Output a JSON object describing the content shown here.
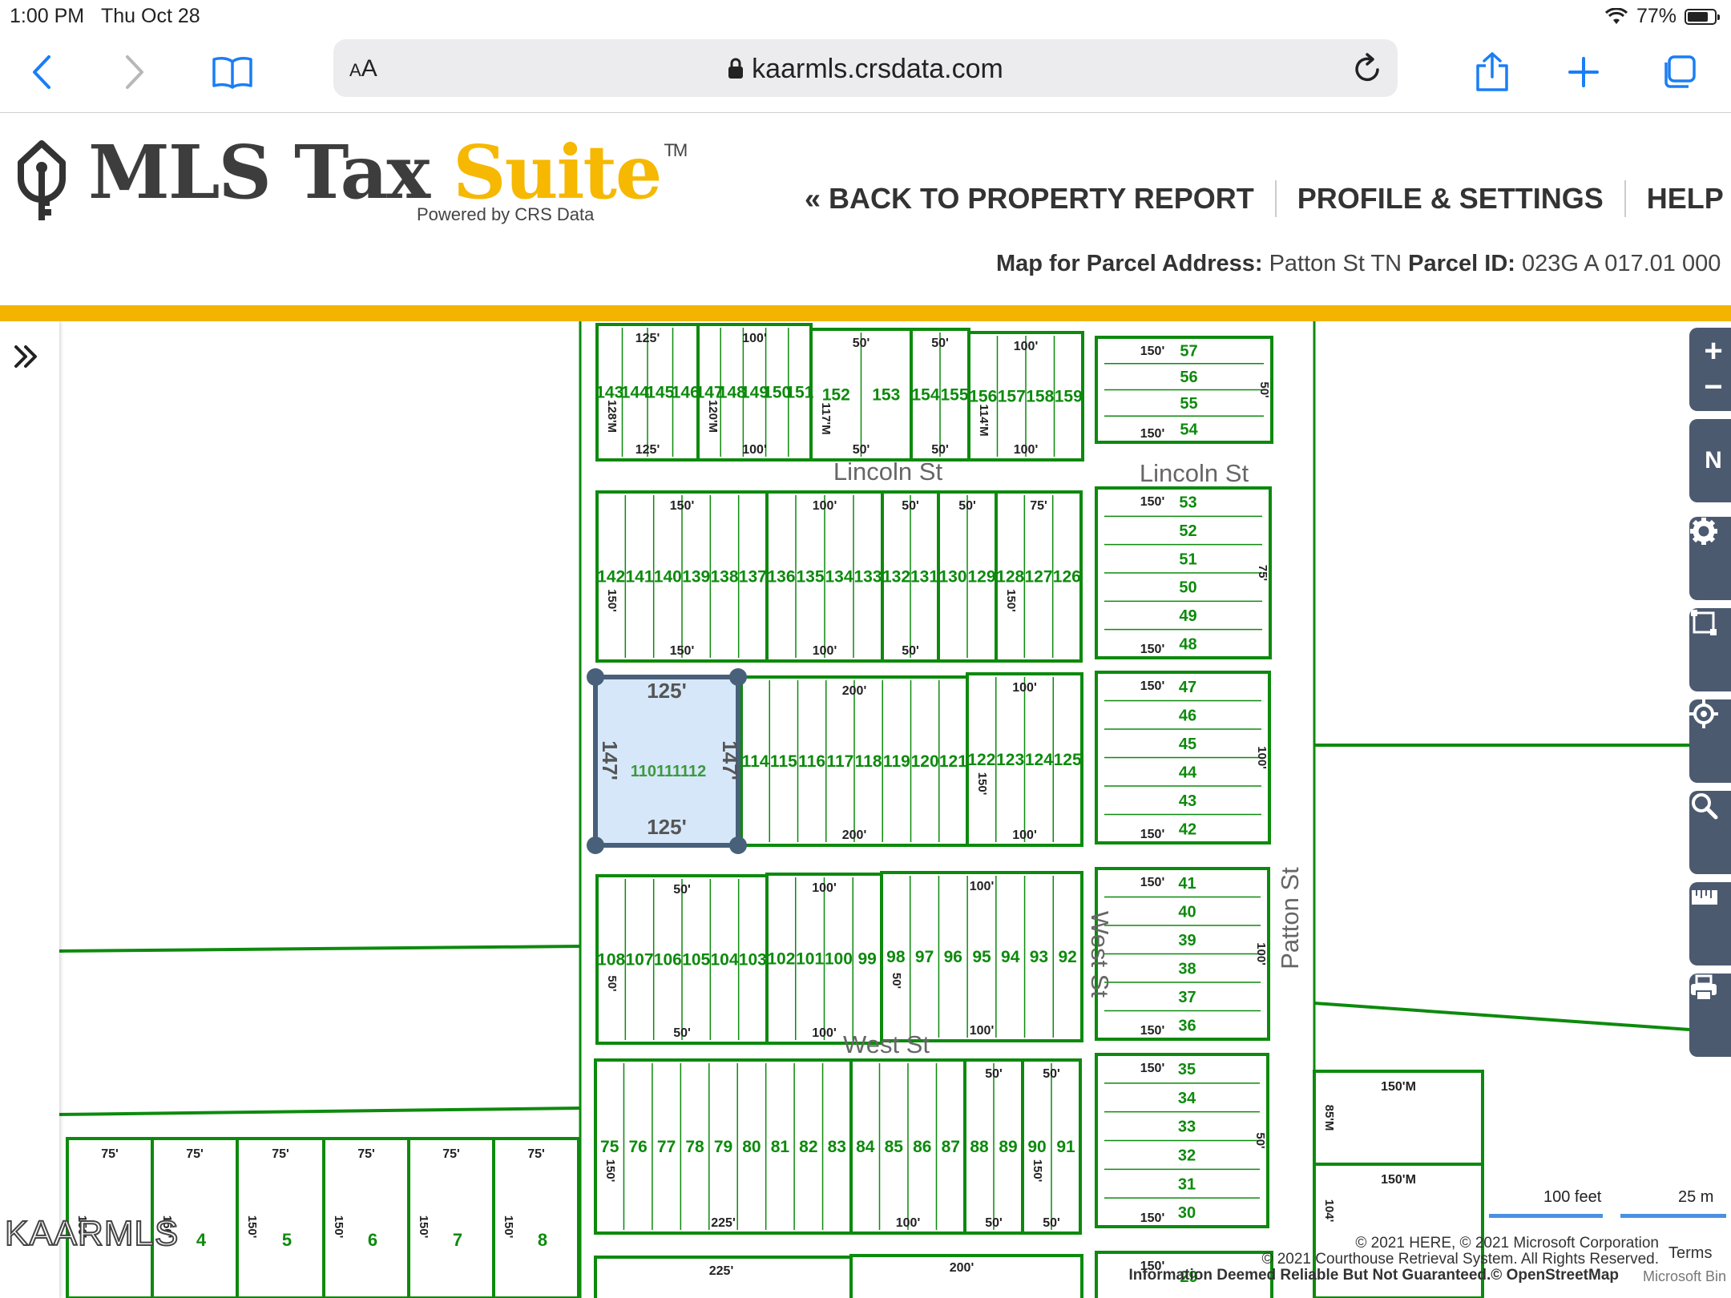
{
  "status": {
    "time": "1:00 PM",
    "date": "Thu Oct 28",
    "battery": "77%",
    "battery_level": 0.77
  },
  "browser": {
    "aa": "A",
    "url": "kaarmls.crsdata.com"
  },
  "header": {
    "brand_main": "MLS Tax ",
    "brand_accent": "Suite",
    "brand_tm": "TM",
    "powered": "Powered by CRS Data",
    "nav": [
      "« BACK TO PROPERTY REPORT",
      "PROFILE & SETTINGS",
      "HELP"
    ],
    "parcel_label_1": "Map for Parcel Address:",
    "parcel_address": " Patton St TN ",
    "parcel_label_2": "Parcel ID:",
    "parcel_id": " 023G A 017.01 000"
  },
  "map": {
    "colors": {
      "lot": "#0d8a0d",
      "selected_fill": "#cfe3f8",
      "selected_stroke": "#48607a",
      "road_label": "#666666"
    },
    "streets": [
      {
        "name": "Lincoln St"
      },
      {
        "name": "Lincoln St"
      },
      {
        "name": "West St"
      },
      {
        "name": "West St"
      },
      {
        "name": "Patton St"
      }
    ],
    "selected_parcel": {
      "top": "125'",
      "bottom": "125'",
      "left": "147'",
      "right": "147'",
      "lots": "110111112"
    },
    "blocks": [
      {
        "top": "125'",
        "bottom": "125'",
        "lots": [
          "143",
          "144",
          "145",
          "146"
        ],
        "side": "128'M"
      },
      {
        "top": "100'",
        "bottom": "100'",
        "lots": [
          "147",
          "148",
          "149",
          "150",
          "151"
        ],
        "side": "120'M"
      },
      {
        "top": "50'",
        "bottom": "50'",
        "lots": [
          "152",
          "153"
        ],
        "side": "117'M"
      },
      {
        "top": "50'",
        "bottom": "50'",
        "lots": [
          "154",
          "155"
        ]
      },
      {
        "top": "100'",
        "bottom": "100'",
        "lots": [
          "156",
          "157",
          "158",
          "159"
        ],
        "side": "114'M"
      },
      {
        "top": "150'",
        "bottom": "150'",
        "lots": [
          "142",
          "141",
          "140",
          "139",
          "138",
          "137"
        ],
        "side": "150'"
      },
      {
        "top": "100'",
        "bottom": "100'",
        "lots": [
          "136",
          "135",
          "134",
          "133"
        ]
      },
      {
        "top": "50'",
        "bottom": "50'",
        "lots": [
          "132",
          "131"
        ]
      },
      {
        "top": "50'",
        "bottom": "",
        "lots": [
          "130",
          "129"
        ]
      },
      {
        "top": "75'",
        "bottom": "",
        "lots": [
          "128",
          "127",
          "126"
        ],
        "side": "150'"
      },
      {
        "top": "200'",
        "bottom": "200'",
        "lots": [
          "114",
          "115",
          "116",
          "117",
          "118",
          "119",
          "120",
          "121"
        ]
      },
      {
        "top": "100'",
        "bottom": "100'",
        "lots": [
          "122",
          "123",
          "124",
          "125"
        ],
        "side": "150'"
      },
      {
        "top": "50'",
        "bottom": "50'",
        "lots": [
          "108",
          "107",
          "106",
          "105",
          "104",
          "103"
        ],
        "side": "50'"
      },
      {
        "top": "100'",
        "bottom": "100'",
        "lots": [
          "102",
          "101",
          "100",
          "99"
        ]
      },
      {
        "top": "100'",
        "bottom": "100'",
        "lots": [
          "98",
          "97",
          "96",
          "95",
          "94",
          "93",
          "92"
        ],
        "side": "50'"
      },
      {
        "top": "",
        "bottom": "225'",
        "lots": [
          "75",
          "76",
          "77",
          "78",
          "79",
          "80",
          "81",
          "82",
          "83"
        ],
        "side": "150'"
      },
      {
        "top": "",
        "bottom": "100'",
        "lots": [
          "84",
          "85",
          "86",
          "87"
        ]
      },
      {
        "top": "50'",
        "bottom": "50'",
        "lots": [
          "88",
          "89"
        ]
      },
      {
        "top": "50'",
        "bottom": "50'",
        "lots": [
          "90",
          "91"
        ],
        "side": "150'"
      }
    ],
    "east_column": [
      {
        "top": "150'",
        "bottom": "150'",
        "lots": [
          "57",
          "56",
          "55",
          "54"
        ],
        "side": "50'"
      },
      {
        "top": "150'",
        "bottom": "150'",
        "lots": [
          "53",
          "52",
          "51",
          "50",
          "49",
          "48"
        ],
        "side": "75'"
      },
      {
        "top": "150'",
        "bottom": "150'",
        "lots": [
          "47",
          "46",
          "45",
          "44",
          "43",
          "42"
        ],
        "side": "100'"
      },
      {
        "top": "150'",
        "bottom": "150'",
        "lots": [
          "41",
          "40",
          "39",
          "38",
          "37",
          "36"
        ],
        "side": "100'"
      },
      {
        "top": "150'",
        "bottom": "150'",
        "lots": [
          "35",
          "34",
          "33",
          "32",
          "31",
          "30"
        ],
        "side": "50'"
      },
      {
        "top": "150'",
        "bottom": "",
        "lots": [
          "29"
        ]
      }
    ],
    "south_row": [
      {
        "top": "75'",
        "lot": "",
        "side": "150'"
      },
      {
        "top": "75'",
        "lot": "4",
        "side": "150'"
      },
      {
        "top": "75'",
        "lot": "5",
        "side": "150'"
      },
      {
        "top": "75'",
        "lot": "6",
        "side": "150'"
      },
      {
        "top": "75'",
        "lot": "7",
        "side": "150'"
      },
      {
        "top": "75'",
        "lot": "8",
        "side": "150'"
      }
    ],
    "patton_east": [
      {
        "top": "150'M",
        "side": "85'M"
      },
      {
        "top": "150'M",
        "side": "104'"
      }
    ],
    "bottom_extra": [
      "225'",
      "200'"
    ],
    "scale": {
      "feet": "100 feet",
      "meters": "25 m"
    },
    "copyright": [
      "© 2021 HERE, © 2021 Microsoft Corporation",
      "© 2021 Courthouse Retrieval System. All Rights Reserved.",
      "Information Deemed Reliable But Not Guaranteed.© OpenStreetMap"
    ],
    "terms": "Terms",
    "microsoft": "Microsoft Bin",
    "watermark": "KAARMLS",
    "controls": [
      "+",
      "−",
      "N"
    ]
  }
}
